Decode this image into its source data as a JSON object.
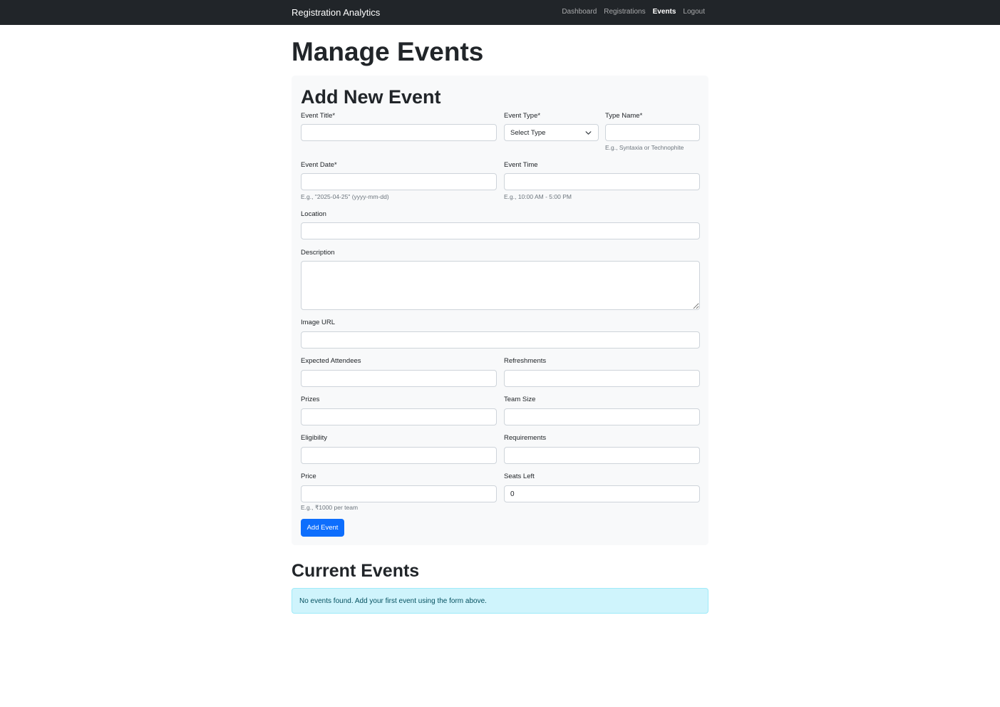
{
  "navbar": {
    "brand": "Registration Analytics",
    "links": [
      {
        "label": "Dashboard"
      },
      {
        "label": "Registrations"
      },
      {
        "label": "Events"
      },
      {
        "label": "Logout"
      }
    ]
  },
  "page_title": "Manage Events",
  "form": {
    "title": "Add New Event",
    "event_title": {
      "label": "Event Title*",
      "value": ""
    },
    "event_type": {
      "label": "Event Type*",
      "selected": "Select Type"
    },
    "type_name": {
      "label": "Type Name*",
      "value": "",
      "help": "E.g., Syntaxia or Technophite"
    },
    "event_date": {
      "label": "Event Date*",
      "value": "",
      "help": "E.g., \"2025-04-25\" (yyyy-mm-dd)"
    },
    "event_time": {
      "label": "Event Time",
      "value": "",
      "help": "E.g., 10:00 AM - 5:00 PM"
    },
    "location": {
      "label": "Location",
      "value": ""
    },
    "description": {
      "label": "Description",
      "value": ""
    },
    "image_url": {
      "label": "Image URL",
      "value": ""
    },
    "expected_attendees": {
      "label": "Expected Attendees",
      "value": ""
    },
    "refreshments": {
      "label": "Refreshments",
      "value": ""
    },
    "prizes": {
      "label": "Prizes",
      "value": ""
    },
    "team_size": {
      "label": "Team Size",
      "value": ""
    },
    "eligibility": {
      "label": "Eligibility",
      "value": ""
    },
    "requirements": {
      "label": "Requirements",
      "value": ""
    },
    "price": {
      "label": "Price",
      "value": "",
      "help": "E.g., ₹1000 per team"
    },
    "seats_left": {
      "label": "Seats Left",
      "value": "0"
    },
    "submit_label": "Add Event"
  },
  "current_events": {
    "title": "Current Events",
    "empty_message": "No events found. Add your first event using the form above."
  },
  "colors": {
    "navbar_bg": "#212529",
    "primary": "#0d6efd",
    "card_bg": "#f8f9fa",
    "alert_bg": "#cff4fc",
    "alert_text": "#055160"
  }
}
